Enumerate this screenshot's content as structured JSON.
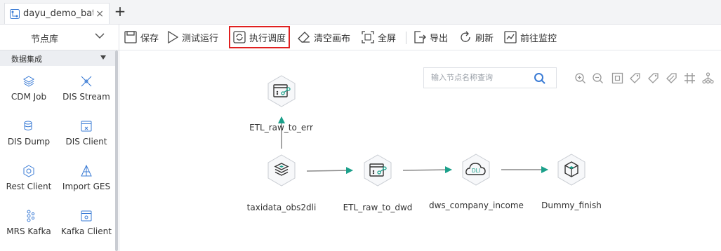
{
  "tab": {
    "title": "dayu_demo_batc...",
    "close": "×",
    "add": "+"
  },
  "sidebar": {
    "title": "节点库",
    "category": "数据集成",
    "items": [
      {
        "label": "CDM Job",
        "icon": "layers-icon"
      },
      {
        "label": "DIS Stream",
        "icon": "stream-icon"
      },
      {
        "label": "DIS Dump",
        "icon": "database-icon"
      },
      {
        "label": "DIS Client",
        "icon": "client-icon"
      },
      {
        "label": "Rest Client",
        "icon": "rest-icon"
      },
      {
        "label": "Import GES",
        "icon": "ges-icon"
      },
      {
        "label": "MRS Kafka",
        "icon": "kafka-icon"
      },
      {
        "label": "Kafka Client",
        "icon": "kafka-client-icon"
      }
    ]
  },
  "toolbar": {
    "save": "保存",
    "test_run": "测试运行",
    "schedule": "执行调度",
    "clear": "清空画布",
    "fullscreen": "全屏",
    "export": "导出",
    "refresh": "刷新",
    "monitor": "前往监控"
  },
  "search": {
    "placeholder": "输入节点名称查询"
  },
  "canvas": {
    "nodes": [
      {
        "id": "etl_err",
        "label": "ETL_raw_to_err",
        "icon": "etl-icon"
      },
      {
        "id": "taxidata",
        "label": "taxidata_obs2dli",
        "icon": "layers-icon"
      },
      {
        "id": "etl_dwd",
        "label": "ETL_raw_to_dwd",
        "icon": "etl-icon"
      },
      {
        "id": "dws",
        "label": "dws_company_income",
        "icon": "dli-cloud-icon",
        "badge": "DLI"
      },
      {
        "id": "dummy",
        "label": "Dummy_finish",
        "icon": "cube-icon"
      }
    ]
  },
  "colors": {
    "accent": "#1aa08a",
    "highlight": "#e02020",
    "search_icon": "#3a7bd5"
  }
}
